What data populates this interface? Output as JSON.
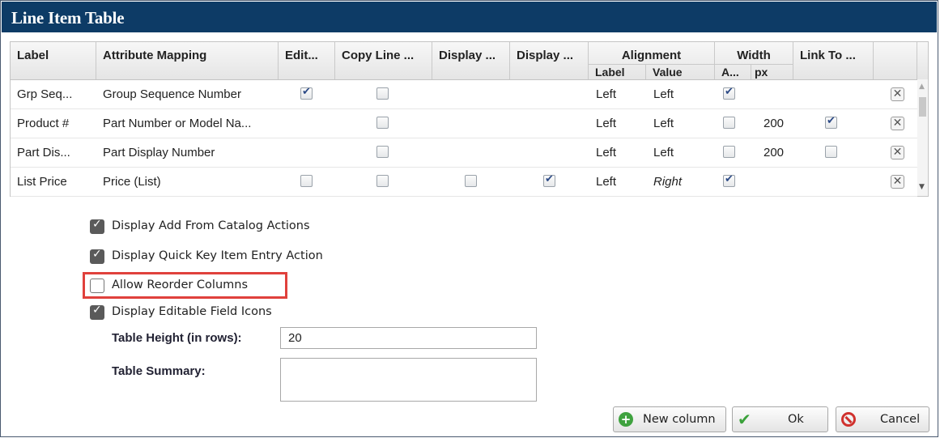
{
  "dialog": {
    "title": "Line Item Table"
  },
  "grid": {
    "headers": {
      "label": "Label",
      "attribute_mapping": "Attribute Mapping",
      "editable": "Edit...",
      "copy_line": "Copy Line ...",
      "display1": "Display ...",
      "display2": "Display ...",
      "alignment": "Alignment",
      "alignment_label": "Label",
      "alignment_value": "Value",
      "width": "Width",
      "width_auto": "A...",
      "width_px": "px",
      "link_to": "Link To ..."
    },
    "rows": [
      {
        "label": "Grp Seq...",
        "mapping": "Group Sequence Number",
        "editable": true,
        "copy_line": false,
        "display1": null,
        "display2": null,
        "align_label": "Left",
        "align_value": "Left",
        "width_auto": true,
        "width_px": "",
        "link_to": null
      },
      {
        "label": "Product #",
        "mapping": "Part Number or Model Na...",
        "editable": null,
        "copy_line": false,
        "display1": null,
        "display2": null,
        "align_label": "Left",
        "align_value": "Left",
        "width_auto": false,
        "width_px": "200",
        "link_to": true
      },
      {
        "label": "Part Dis...",
        "mapping": "Part Display Number",
        "editable": null,
        "copy_line": false,
        "display1": null,
        "display2": null,
        "align_label": "Left",
        "align_value": "Left",
        "width_auto": false,
        "width_px": "200",
        "link_to": false
      },
      {
        "label": "List Price",
        "mapping": "Price (List)",
        "editable": false,
        "copy_line": false,
        "display1": false,
        "display2": true,
        "align_label": "Left",
        "align_value": "Right",
        "width_auto": true,
        "width_px": "",
        "link_to": null
      }
    ],
    "delete_glyph": "✕",
    "scroll_up_glyph": "▲",
    "scroll_down_glyph": "▼"
  },
  "options": [
    {
      "label": "Display Add From Catalog Actions",
      "checked": true
    },
    {
      "label": "Display Quick Key Item Entry Action",
      "checked": true
    },
    {
      "label": "Allow Reorder Columns",
      "checked": false
    },
    {
      "label": "Display Editable Field Icons",
      "checked": true
    }
  ],
  "fields": {
    "table_height_label": "Table Height (in rows):",
    "table_height_value": "20",
    "table_summary_label": "Table Summary:",
    "table_summary_value": ""
  },
  "buttons": {
    "new_column": "New column",
    "ok": "Ok",
    "cancel": "Cancel"
  },
  "icons": {
    "new_column": "plus-circle-icon",
    "ok": "checkmark-icon",
    "cancel": "no-entry-icon",
    "delete_row": "close-icon"
  },
  "colors": {
    "title_bar": "#0d3b66",
    "highlight_box": "#e0413c",
    "checkbox_check": "#2c4a86"
  }
}
